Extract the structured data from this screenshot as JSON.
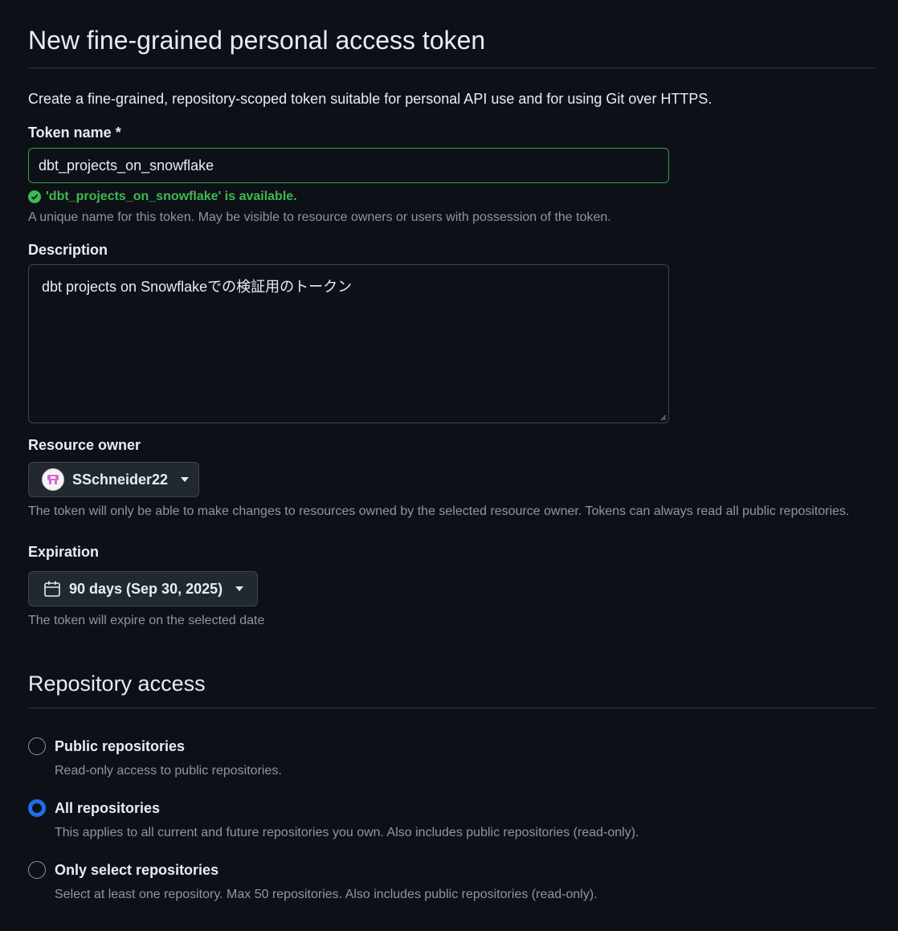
{
  "page_title": "New fine-grained personal access token",
  "intro": "Create a fine-grained, repository-scoped token suitable for personal API use and for using Git over HTTPS.",
  "token_name": {
    "label": "Token name *",
    "value": "dbt_projects_on_snowflake",
    "availability": "'dbt_projects_on_snowflake' is available.",
    "hint": "A unique name for this token. May be visible to resource owners or users with possession of the token."
  },
  "description": {
    "label": "Description",
    "value": "dbt projects on Snowflakeでの検証用のトークン"
  },
  "resource_owner": {
    "label": "Resource owner",
    "selected": "SSchneider22",
    "hint": "The token will only be able to make changes to resources owned by the selected resource owner. Tokens can always read all public repositories."
  },
  "expiration": {
    "label": "Expiration",
    "selected": "90 days (Sep 30, 2025)",
    "hint": "The token will expire on the selected date"
  },
  "repository_access": {
    "title": "Repository access",
    "options": [
      {
        "label": "Public repositories",
        "hint": "Read-only access to public repositories.",
        "checked": false
      },
      {
        "label": "All repositories",
        "hint": "This applies to all current and future repositories you own. Also includes public repositories (read-only).",
        "checked": true
      },
      {
        "label": "Only select repositories",
        "hint": "Select at least one repository. Max 50 repositories. Also includes public repositories (read-only).",
        "checked": false
      }
    ]
  },
  "colors": {
    "background": "#0d1117",
    "success": "#3fb950",
    "accent": "#1f6feb",
    "muted": "#8d96a0"
  },
  "icons": [
    "check-circle-icon",
    "calendar-icon",
    "caret-down-icon",
    "avatar"
  ]
}
